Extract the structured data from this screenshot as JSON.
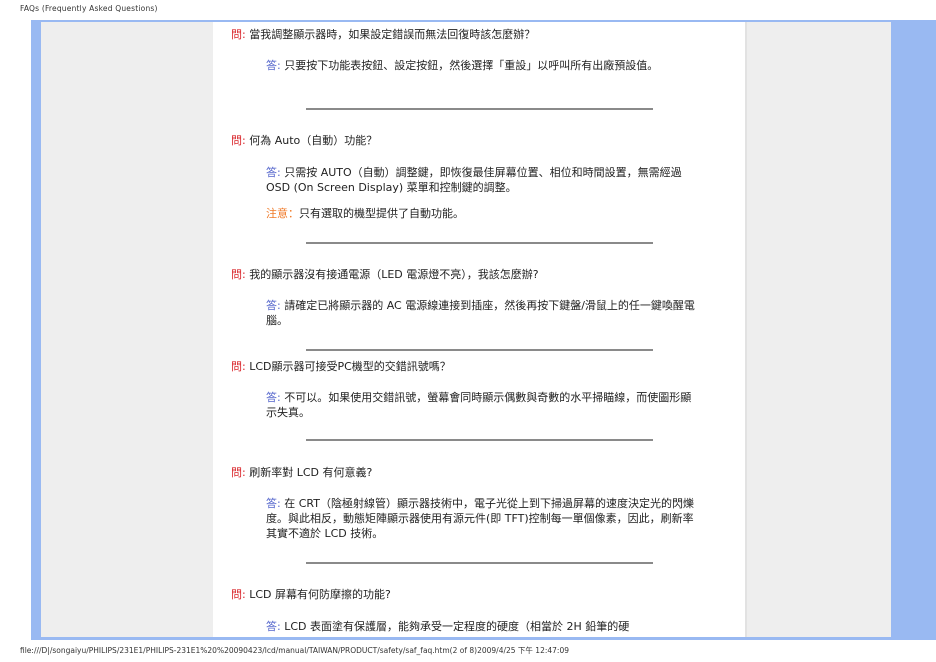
{
  "header": {
    "title": "FAQs (Frequently Asked Questions)"
  },
  "labels": {
    "q": "問:",
    "a": "答:",
    "note": "注意："
  },
  "faqs": [
    {
      "q": "當我調整顯示器時，如果設定錯誤而無法回復時該怎麼辦？",
      "a": "只要按下功能表按鈕、設定按鈕，然後選擇「重設」以呼叫所有出廠預設值。"
    },
    {
      "q": "何為 Auto（自動）功能？",
      "a": "只需按 AUTO（自動）調整鍵，即恢復最佳屏幕位置、相位和時間設置，無需經過 OSD (On Screen Display) 菜單和控制鍵的調整。",
      "note": "只有選取的機型提供了自動功能。"
    },
    {
      "q": "我的顯示器沒有接通電源（LED 電源燈不亮），我該怎麼辦?",
      "a": "請確定已將顯示器的 AC 電源線連接到插座，然後再按下鍵盤/滑鼠上的任一鍵喚醒電腦。"
    },
    {
      "q": "LCD顯示器可接受PC機型的交錯訊號嗎？",
      "a": "不可以。如果使用交錯訊號，螢幕會同時顯示偶數與奇數的水平掃瞄線，而使圖形顯示失真。"
    },
    {
      "q": "刷新率對 LCD 有何意義?",
      "a": "在 CRT（陰極射線管）顯示器技術中，電子光從上到下掃過屏幕的速度決定光的閃爍度。與此相反，動態矩陣顯示器使用有源元件(即 TFT)控制每一單個像素，因此，刷新率其實不適於 LCD 技術。"
    },
    {
      "q": "LCD 屏幕有何防摩擦的功能?",
      "a": "LCD 表面塗有保護層，能夠承受一定程度的硬度（相當於 2H 鉛筆的硬"
    }
  ],
  "footer": {
    "path": "file:///D|/songaiyu/PHILIPS/231E1/PHILIPS-231E1%20%20090423/lcd/manual/TAIWAN/PRODUCT/safety/saf_faq.htm(2 of 8)2009/4/25 下午 12:47:09"
  }
}
